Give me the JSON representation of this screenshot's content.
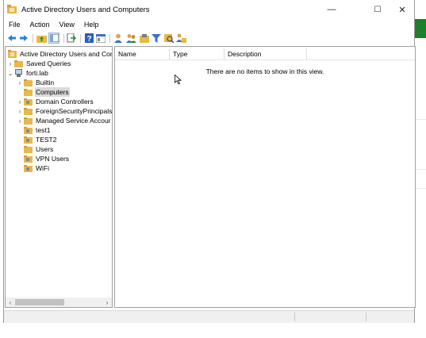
{
  "window": {
    "title": "Active Directory Users and Computers",
    "controls": {
      "minimize": "—",
      "maximize": "☐",
      "close": "✕"
    }
  },
  "menu": [
    "File",
    "Action",
    "View",
    "Help"
  ],
  "toolbar": {
    "icons": [
      "back-arrow-icon",
      "forward-arrow-icon",
      "up-folder-icon",
      "console-tree-icon",
      "export-list-icon",
      "help-icon",
      "properties-icon",
      "user-icon",
      "group-icon",
      "container-icon",
      "filter-icon",
      "find-icon",
      "delegate-icon"
    ]
  },
  "tree": {
    "root": "Active Directory Users and Com",
    "saved_queries": "Saved Queries",
    "domain": "forti.lab",
    "items": [
      {
        "label": "Builtin",
        "expandable": true
      },
      {
        "label": "Computers",
        "expandable": false,
        "selected": true
      },
      {
        "label": "Domain Controllers",
        "expandable": true
      },
      {
        "label": "ForeignSecurityPrincipals",
        "expandable": true
      },
      {
        "label": "Managed Service Accour",
        "expandable": true
      },
      {
        "label": "test1",
        "expandable": false
      },
      {
        "label": "TEST2",
        "expandable": false
      },
      {
        "label": "Users",
        "expandable": false
      },
      {
        "label": "VPN Users",
        "expandable": false
      },
      {
        "label": "WiFi",
        "expandable": false
      }
    ]
  },
  "details": {
    "columns": [
      "Name",
      "Type",
      "Description"
    ],
    "empty_message": "There are no items to show in this view."
  },
  "colors": {
    "folder": "#e8b84a",
    "accent_green": "#1e7f2b",
    "selection": "#d9d9d9"
  }
}
